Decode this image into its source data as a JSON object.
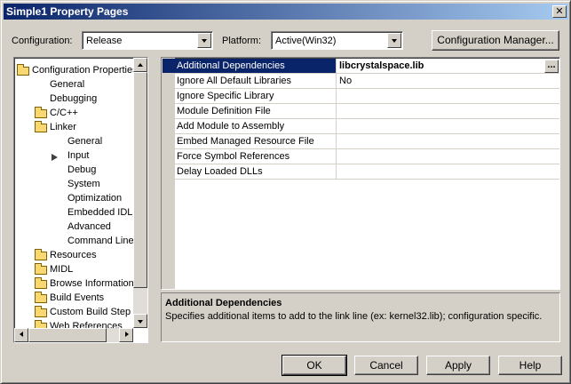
{
  "window": {
    "title": "Simple1 Property Pages",
    "close_glyph": "✕"
  },
  "configuration": {
    "label": "Configuration:",
    "value": "Release"
  },
  "platform": {
    "label": "Platform:",
    "value": "Active(Win32)"
  },
  "config_manager_label": "Configuration Manager...",
  "tree": {
    "items": [
      {
        "label": "Configuration Properties",
        "icon": "open-folder-icon"
      },
      {
        "label": "General"
      },
      {
        "label": "Debugging"
      },
      {
        "label": "C/C++",
        "icon": "folder-icon"
      },
      {
        "label": "Linker",
        "icon": "open-folder-icon"
      },
      {
        "label": "General"
      },
      {
        "label": "Input",
        "icon": "arrow-right-icon"
      },
      {
        "label": "Debug"
      },
      {
        "label": "System"
      },
      {
        "label": "Optimization"
      },
      {
        "label": "Embedded IDL"
      },
      {
        "label": "Advanced"
      },
      {
        "label": "Command Line"
      },
      {
        "label": "Resources",
        "icon": "folder-icon"
      },
      {
        "label": "MIDL",
        "icon": "folder-icon"
      },
      {
        "label": "Browse Information",
        "icon": "folder-icon"
      },
      {
        "label": "Build Events",
        "icon": "folder-icon"
      },
      {
        "label": "Custom Build Step",
        "icon": "folder-icon"
      },
      {
        "label": "Web References",
        "icon": "folder-icon"
      }
    ]
  },
  "properties": [
    {
      "name": "Additional Dependencies",
      "value": "libcrystalspace.lib"
    },
    {
      "name": "Ignore All Default Libraries",
      "value": "No"
    },
    {
      "name": "Ignore Specific Library",
      "value": ""
    },
    {
      "name": "Module Definition File",
      "value": ""
    },
    {
      "name": "Add Module to Assembly",
      "value": ""
    },
    {
      "name": "Embed Managed Resource File",
      "value": ""
    },
    {
      "name": "Force Symbol References",
      "value": ""
    },
    {
      "name": "Delay Loaded DLLs",
      "value": ""
    }
  ],
  "ellipsis_label": "...",
  "description": {
    "title": "Additional Dependencies",
    "text": "Specifies additional items to add to the link line (ex: kernel32.lib); configuration specific."
  },
  "buttons": {
    "ok": "OK",
    "cancel": "Cancel",
    "apply": "Apply",
    "help": "Help"
  },
  "colors": {
    "selection": "#0a246a",
    "face": "#d4d0c8"
  }
}
